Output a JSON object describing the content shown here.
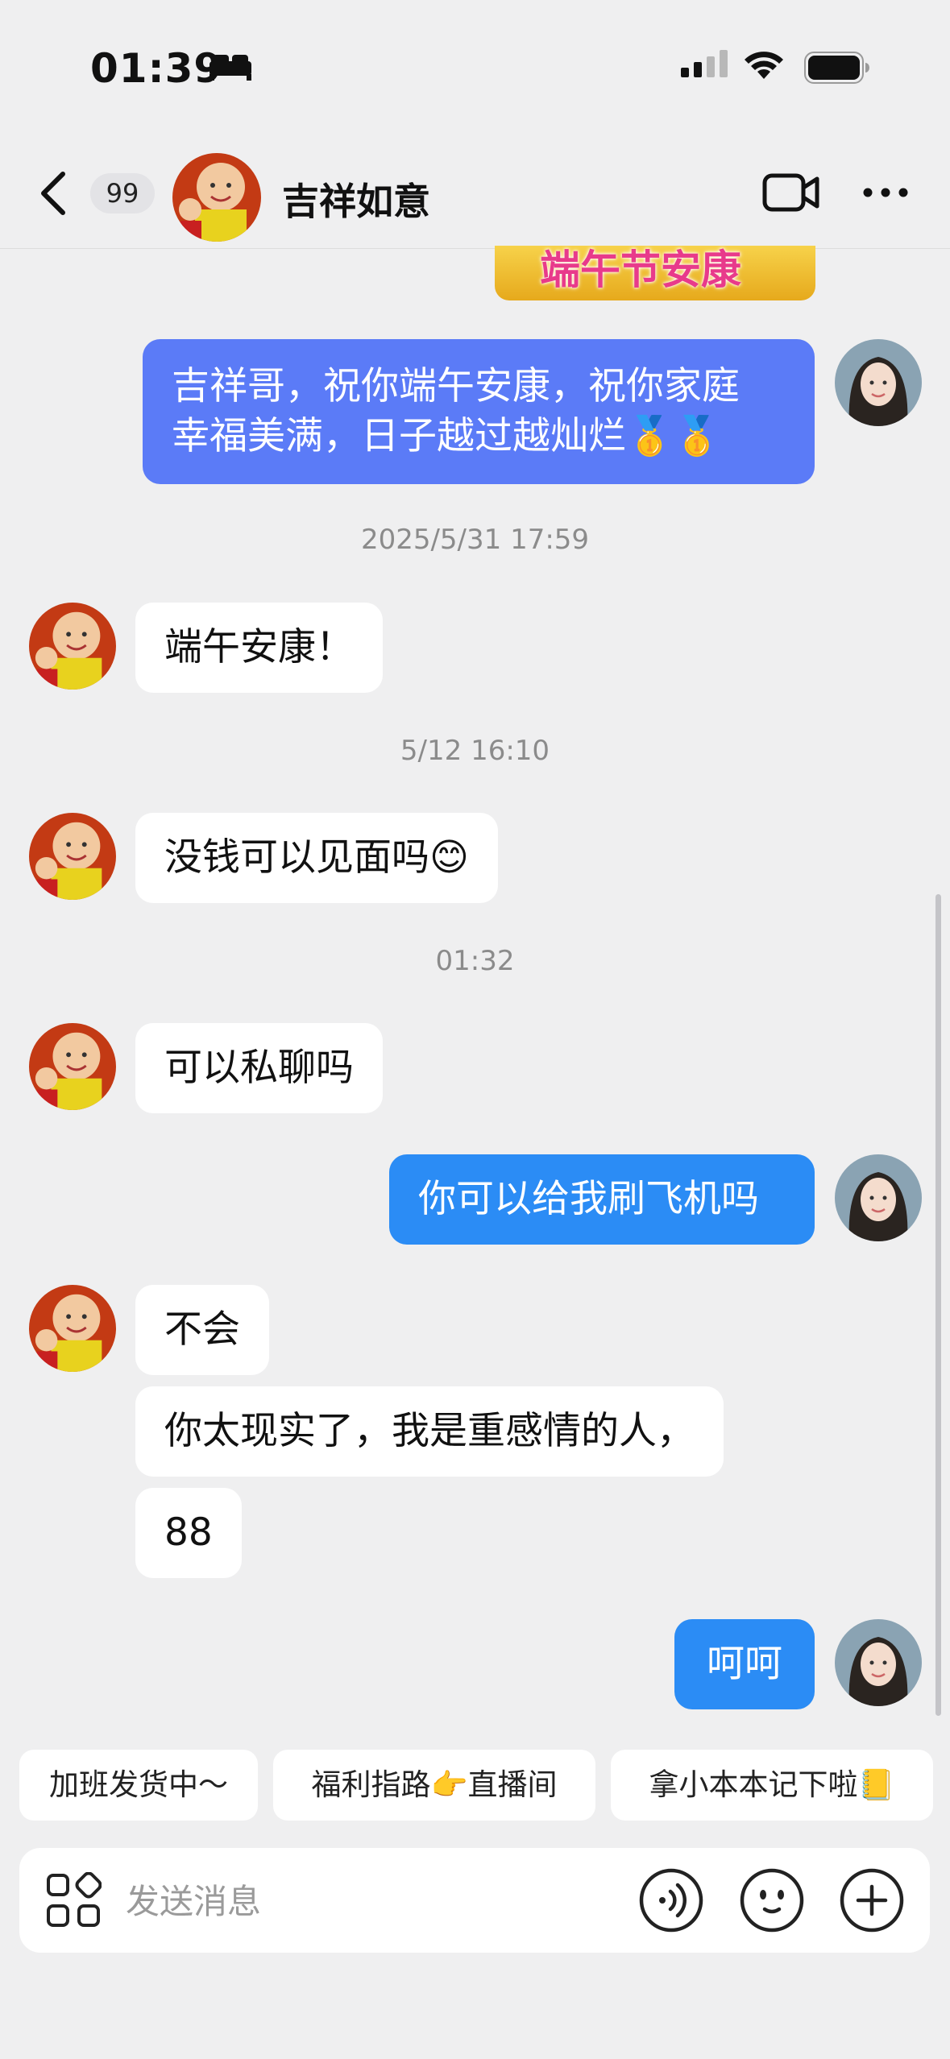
{
  "status": {
    "time": "01:39"
  },
  "header": {
    "unread_count": "99",
    "contact_name": "吉祥如意"
  },
  "messages": {
    "image_caption": "端午节安康",
    "m1_line1": "吉祥哥，祝你端午安康，祝你家庭",
    "m1_line2": "幸福美满，日子越过越灿烂",
    "m1_emoji": "🥇🥇",
    "ts1": "2025/5/31 17:59",
    "m2": "端午安康！",
    "ts2": "5/12 16:10",
    "m3": "没钱可以见面吗",
    "m3_emoji": "😊",
    "ts3": "01:32",
    "m4": "可以私聊吗",
    "m5": "你可以给我刷飞机吗",
    "m6": "不会",
    "m7": "你太现实了，我是重感情的人，",
    "m8": "88",
    "m9": "呵呵"
  },
  "quick_replies": {
    "r1": "加班发货中～",
    "r2_a": "福利指路",
    "r2_emoji": "👉",
    "r2_b": "直播间",
    "r3": "拿小本本记下啦",
    "r3_emoji": "📒"
  },
  "input": {
    "placeholder": "发送消息"
  },
  "colors": {
    "sent_bubble": "#2b8cf5",
    "sent_bubble_alt": "#5b7bf7",
    "received_bubble": "#ffffff",
    "background": "#efeff0"
  }
}
